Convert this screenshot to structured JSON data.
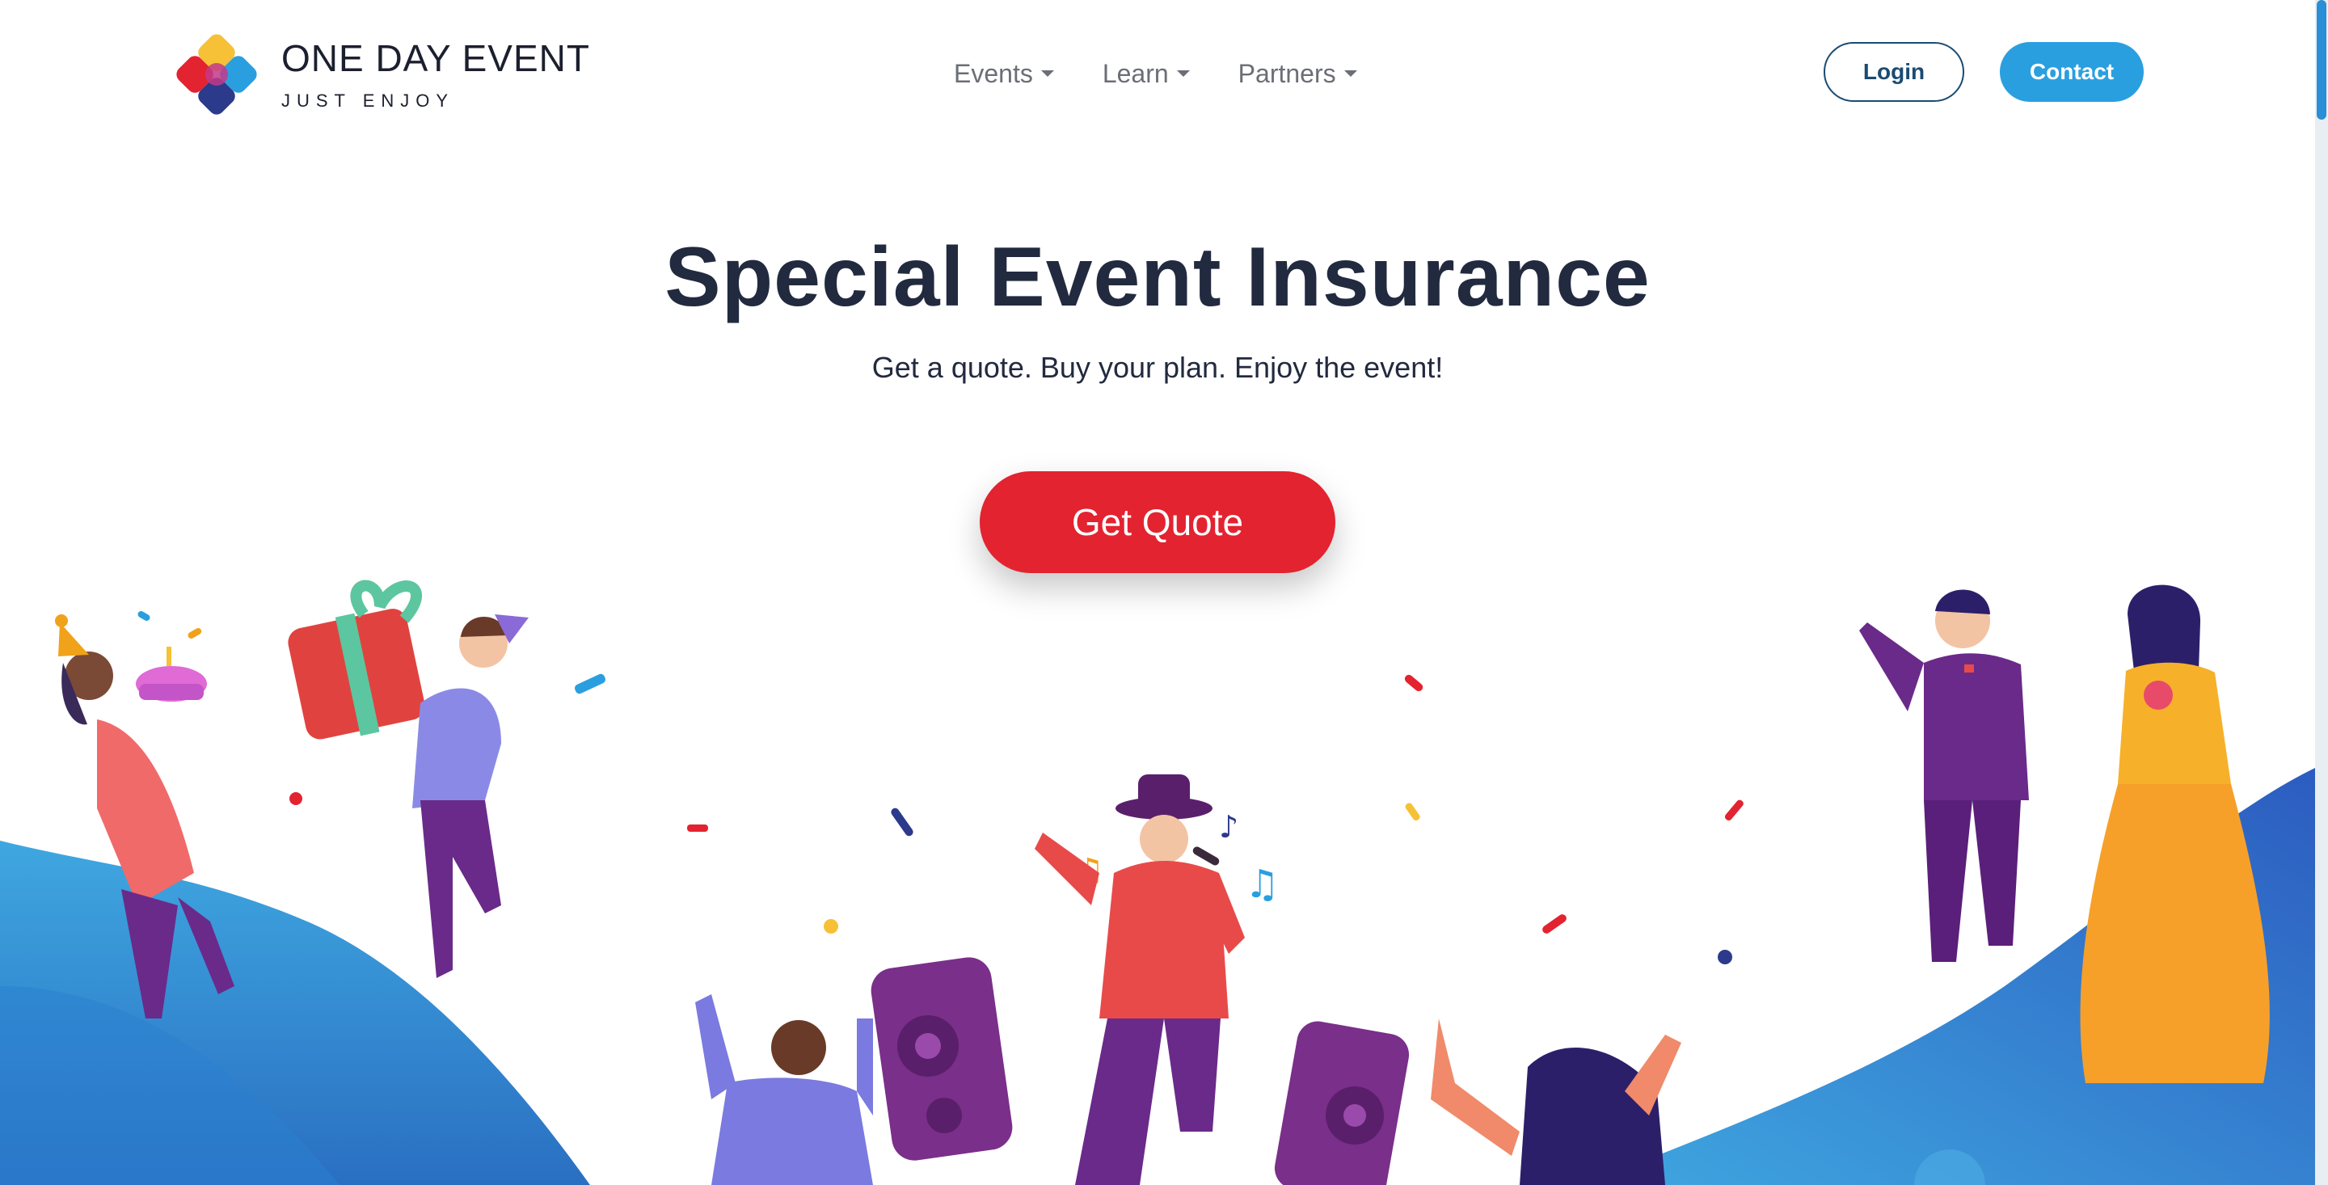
{
  "brand": {
    "name": "ONE DAY EVENT",
    "tagline": "JUST ENJOY"
  },
  "nav": {
    "items": [
      {
        "label": "Events"
      },
      {
        "label": "Learn"
      },
      {
        "label": "Partners"
      }
    ],
    "login_label": "Login",
    "contact_label": "Contact"
  },
  "hero": {
    "title": "Special Event Insurance",
    "subtitle": "Get a quote. Buy your plan. Enjoy the event!",
    "cta_label": "Get Quote"
  },
  "colors": {
    "accent": "#2a9fe0",
    "cta": "#e32330",
    "heading": "#222a3f",
    "login_border": "#1a4b72"
  },
  "illustration": {
    "icons": [
      "party-people-illustration",
      "speaker-icon",
      "music-note-icon",
      "confetti"
    ]
  }
}
